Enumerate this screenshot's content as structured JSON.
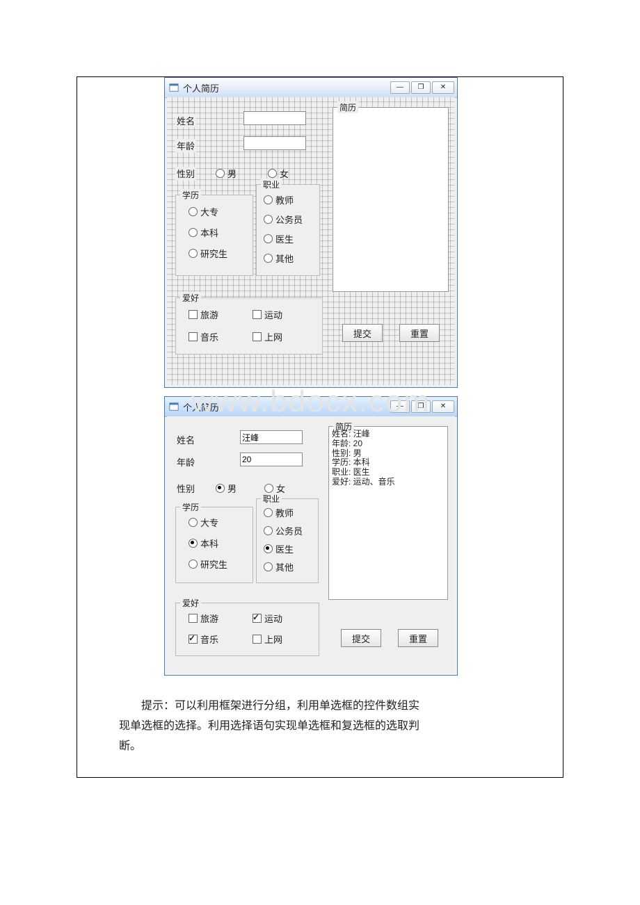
{
  "window": {
    "title": "个人简历",
    "buttons": {
      "min": "—",
      "max": "❐",
      "close": "✕"
    }
  },
  "labels": {
    "name": "姓名",
    "age": "年龄",
    "gender": "性别",
    "resume": "简历"
  },
  "gender": {
    "male": "男",
    "female": "女"
  },
  "education": {
    "legend": "学历",
    "opt1": "大专",
    "opt2": "本科",
    "opt3": "研究生"
  },
  "job": {
    "legend": "职业",
    "opt1": "教师",
    "opt2": "公务员",
    "opt3": "医生",
    "opt4": "其他"
  },
  "hobby": {
    "legend": "爱好",
    "opt1": "旅游",
    "opt2": "运动",
    "opt3": "音乐",
    "opt4": "上网"
  },
  "buttons": {
    "submit": "提交",
    "reset": "重置"
  },
  "run": {
    "name_value": "汪峰",
    "age_value": "20",
    "resume_text": "姓名: 汪峰\n年龄: 20\n性别: 男\n学历: 本科\n职业: 医生\n爱好: 运动、音乐"
  },
  "watermark": "www.bdocx.com",
  "explain": {
    "line1": "提示：可以利用框架进行分组，利用单选框的控件数组实",
    "line2": "现单选框的选择。利用选择语句实现单选框和复选框的选取判",
    "line3": "断。"
  }
}
